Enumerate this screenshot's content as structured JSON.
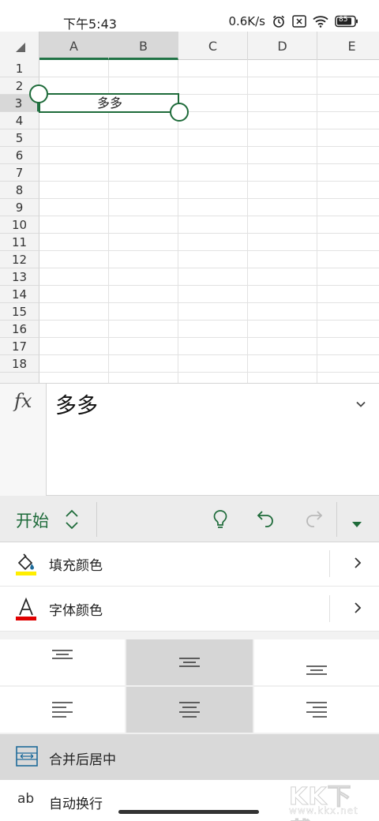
{
  "status_bar": {
    "time": "下午5:43",
    "net_speed": "0.6K/s",
    "battery_level": "85"
  },
  "sheet": {
    "columns": [
      "A",
      "B",
      "C",
      "D",
      "E"
    ],
    "rows": [
      "1",
      "2",
      "3",
      "4",
      "5",
      "6",
      "7",
      "8",
      "9",
      "10",
      "11",
      "12",
      "13",
      "14",
      "15",
      "16",
      "17",
      "18"
    ],
    "selected_columns": [
      "A",
      "B"
    ],
    "selected_row": "3",
    "cell_value": "多多"
  },
  "formula_bar": {
    "fx_label": "fx",
    "value": "多多"
  },
  "ribbon": {
    "tab_label": "开始"
  },
  "options": {
    "fill_color": "填充颜色",
    "font_color": "字体颜色",
    "merge_center": "合并后居中",
    "wrap_text": "自动换行",
    "wrap_icon_text": "ab"
  },
  "watermark": {
    "brand": "KK下载",
    "url": "www.kkx.net"
  },
  "colors": {
    "accent": "#1e6b3a",
    "fill_swatch": "#ffee00",
    "font_swatch": "#e00000"
  }
}
